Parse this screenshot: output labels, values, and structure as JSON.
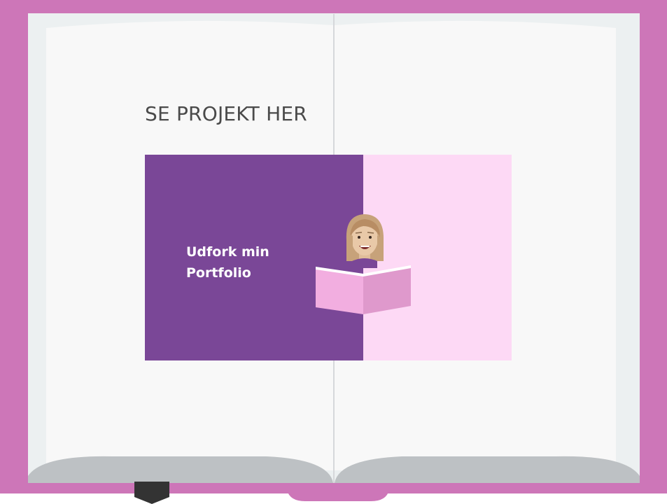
{
  "heading": "SE PROJEKT HER",
  "card": {
    "title_line1": "Udfork min",
    "title_line2": "Portfolio"
  },
  "colors": {
    "book_cover": "#cd76b8",
    "page_inner": "#ecf0f1",
    "page_paper": "#f8f8f8",
    "page_bottom": "#bdc1c4",
    "bookmark": "#333333",
    "card_left": "#7a4797",
    "card_right": "#fdd9f5",
    "heading_text": "#4a4a4a"
  },
  "icons": {
    "reader": "person-reading-book-icon",
    "bookmark": "bookmark-ribbon-icon"
  }
}
